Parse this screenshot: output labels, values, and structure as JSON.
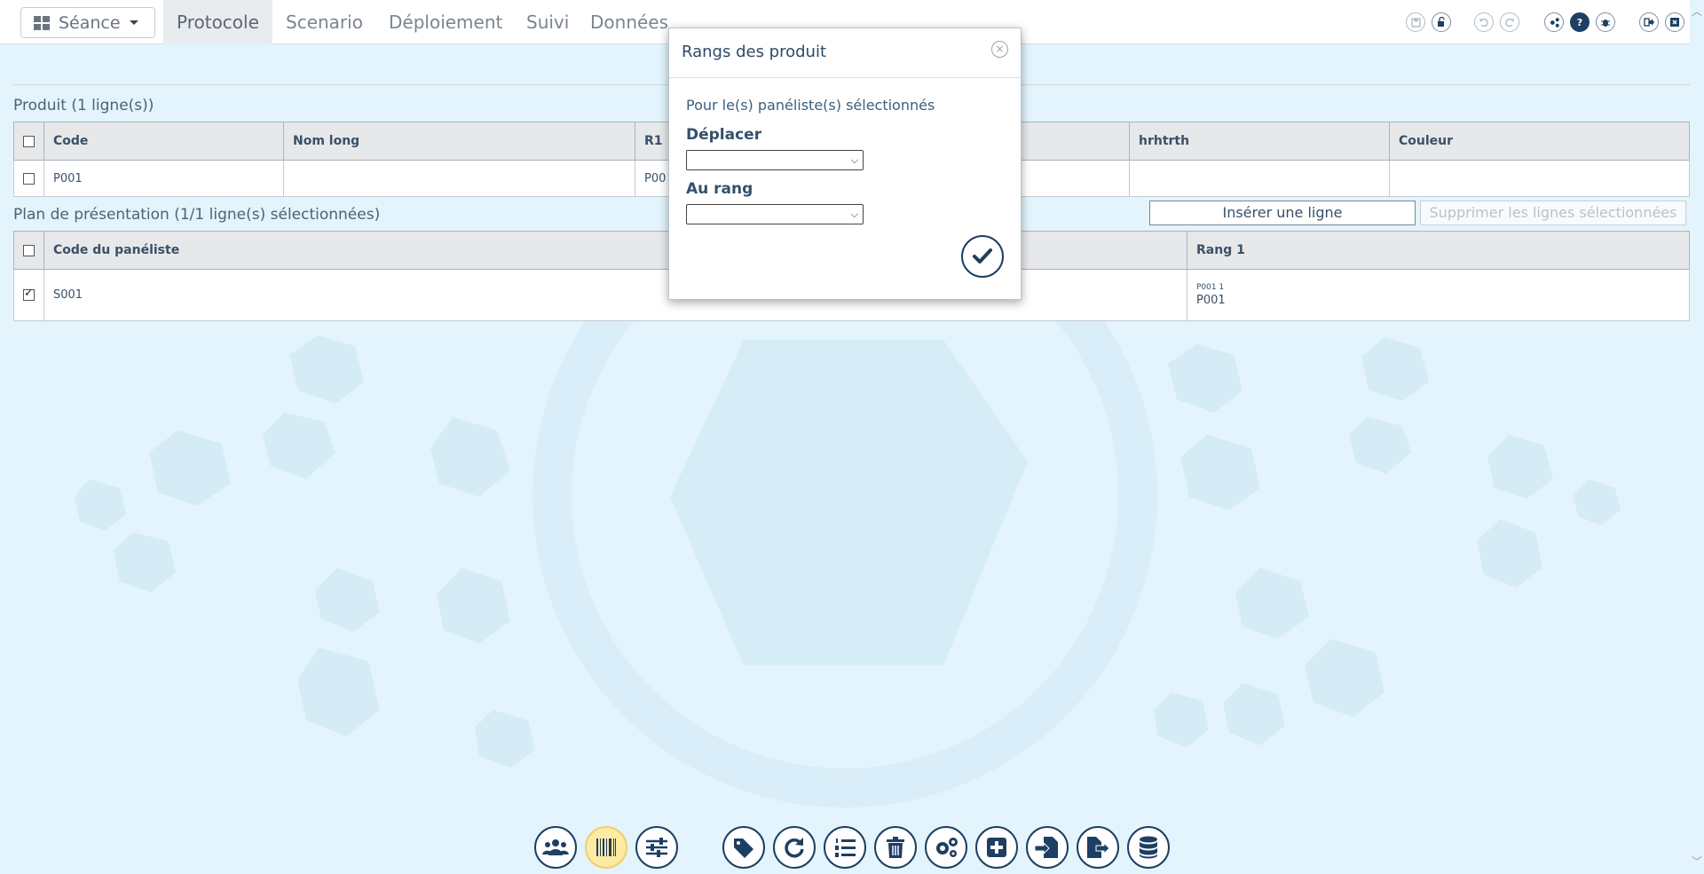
{
  "topbar": {
    "seance_label": "Séance",
    "tabs": [
      {
        "label": "Protocole",
        "active": true
      },
      {
        "label": "Scenario",
        "active": false
      },
      {
        "label": "Déploiement",
        "active": false
      },
      {
        "label": "Suivi",
        "active": false
      },
      {
        "label": "Données",
        "active": false
      }
    ],
    "icons": [
      "save-icon",
      "unlock-icon",
      "undo-icon",
      "redo-icon",
      "settings-share-icon",
      "help-icon",
      "bug-icon",
      "logout-icon",
      "close-window-icon"
    ]
  },
  "produit": {
    "title": "Produit (1 ligne(s))",
    "columns": [
      "Code",
      "Nom long",
      "R1",
      "hrhtrth",
      "Couleur"
    ],
    "rows": [
      {
        "code": "P001",
        "nom_long": "",
        "r1": "P00",
        "hrhtrth": "",
        "couleur": ""
      }
    ]
  },
  "plan": {
    "title": "Plan de présentation (1/1 ligne(s) sélectionnées)",
    "insert_label": "Insérer une ligne",
    "delete_label": "Supprimer les lignes sélectionnées",
    "columns": [
      "Code du panéliste",
      "Rang 1"
    ],
    "rows": [
      {
        "code": "S001",
        "rang1_small": "P001 1",
        "rang1": "P001",
        "checked": true
      }
    ]
  },
  "modal": {
    "title": "Rangs des produit",
    "info": "Pour le(s) panéliste(s) sélectionnés",
    "move_label": "Déplacer",
    "rank_label": "Au rang",
    "move_value": "",
    "rank_value": ""
  },
  "bottom_toolbar": [
    "panelists-icon",
    "barcode-icon",
    "sliders-icon",
    "tags-icon",
    "refresh-icon",
    "ordered-list-icon",
    "trash-icon",
    "cogs-icon",
    "plus-square-icon",
    "file-import-icon",
    "file-export-icon",
    "database-icon"
  ],
  "colors": {
    "accent": "#1d3f63",
    "background": "#e3f4fc",
    "active_button": "#fdeba3"
  }
}
